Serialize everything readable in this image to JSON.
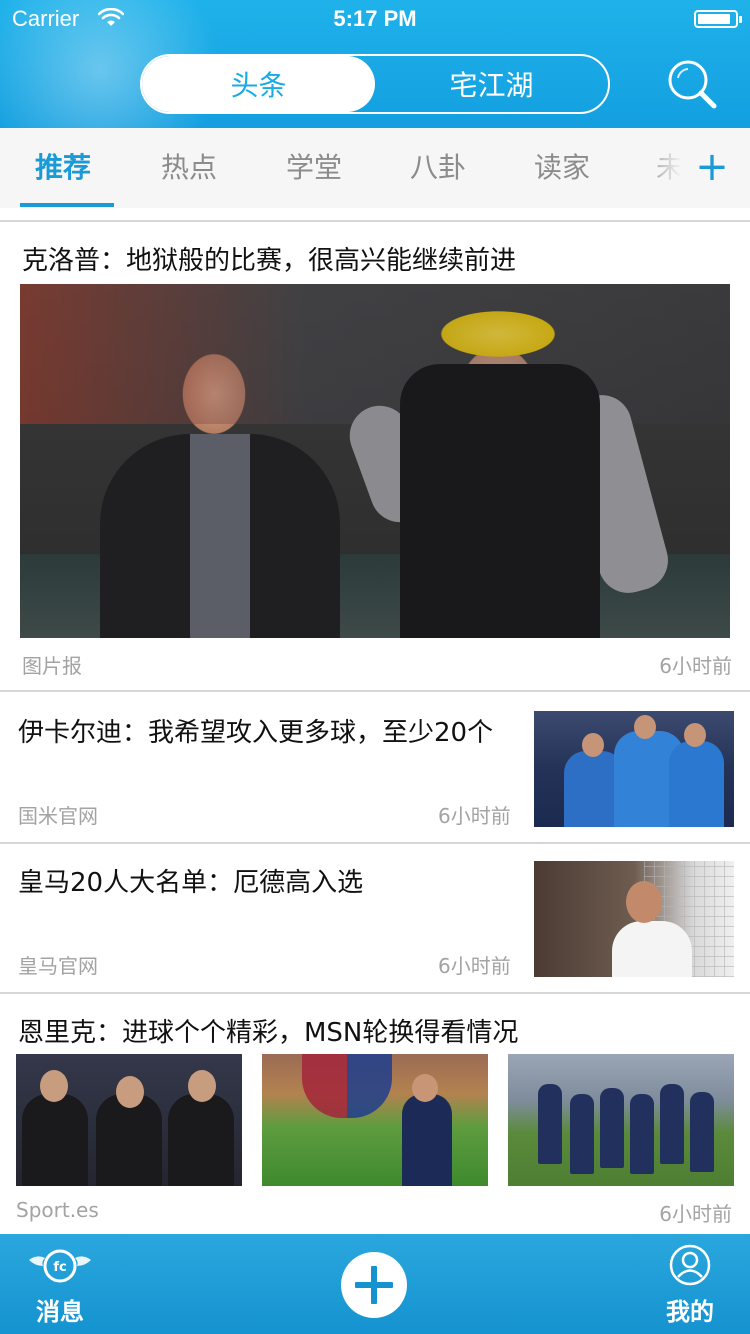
{
  "status_bar": {
    "carrier": "Carrier",
    "time": "5:17 PM",
    "battery_level": 0.9
  },
  "header": {
    "segments": [
      "头条",
      "宅江湖"
    ],
    "active_segment": 0
  },
  "tabs": {
    "items": [
      "推荐",
      "热点",
      "学堂",
      "八卦",
      "读家",
      "未"
    ],
    "active": 0,
    "add_label": "+"
  },
  "articles": [
    {
      "title": "克洛普：地狱般的比赛，很高兴能继续前进",
      "source": "图片报",
      "time": "6小时前"
    },
    {
      "title": "伊卡尔迪：我希望攻入更多球，至少20个",
      "source": "国米官网",
      "time": "6小时前"
    },
    {
      "title": "皇马20人大名单：厄德高入选",
      "source": "皇马官网",
      "time": "6小时前"
    },
    {
      "title": "恩里克：进球个个精彩，MSN轮换得看情况",
      "source": "Sport.es",
      "time": "6小时前"
    }
  ],
  "tabbar": {
    "left_label": "消息",
    "right_label": "我的",
    "badge_text": "fc"
  },
  "colors": {
    "accent": "#1a9ad6",
    "header": "#139fe0"
  }
}
